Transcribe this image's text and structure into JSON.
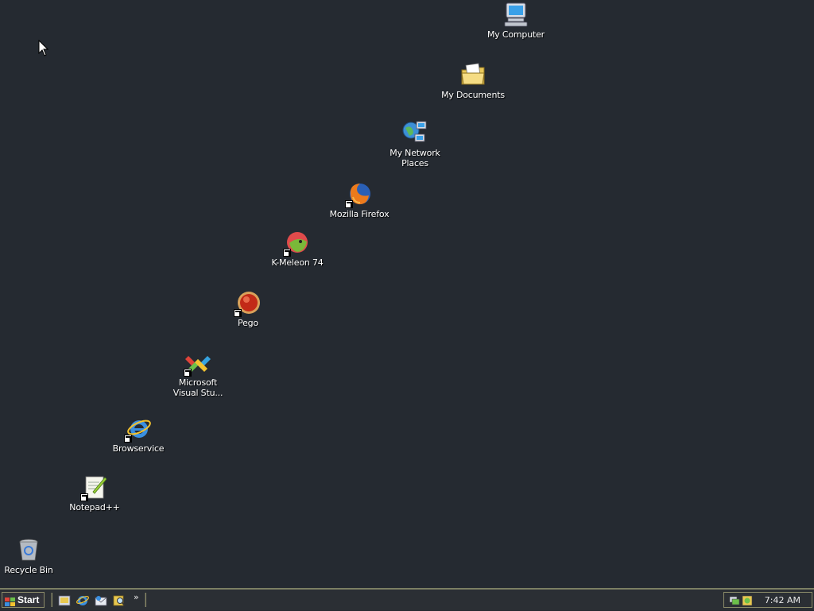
{
  "desktop": {
    "icons": {
      "my_computer": "My Computer",
      "my_documents": "My Documents",
      "my_network_places_line1": "My Network",
      "my_network_places_line2": "Places",
      "mozilla_firefox": "Mozilla Firefox",
      "k_meleon": "K-Meleon 74",
      "pego": "Pego",
      "ms_visual_studio_line1": "Microsoft",
      "ms_visual_studio_line2": "Visual Stu...",
      "browservice": "Browservice",
      "notepad_pp": "Notepad++",
      "recycle_bin": "Recycle Bin"
    },
    "background_color": "#252a31"
  },
  "taskbar": {
    "start_label": "Start",
    "quick_launch": [
      "show-desktop-icon",
      "internet-explorer-icon",
      "outlook-express-icon",
      "search-icon"
    ],
    "overflow_label": "»",
    "tray": {
      "icons": [
        "network-tray-icon",
        "update-tray-icon"
      ],
      "clock": "7:42 AM"
    }
  },
  "colors": {
    "accent": "#7c7f63",
    "label_text": "#ffffff"
  }
}
